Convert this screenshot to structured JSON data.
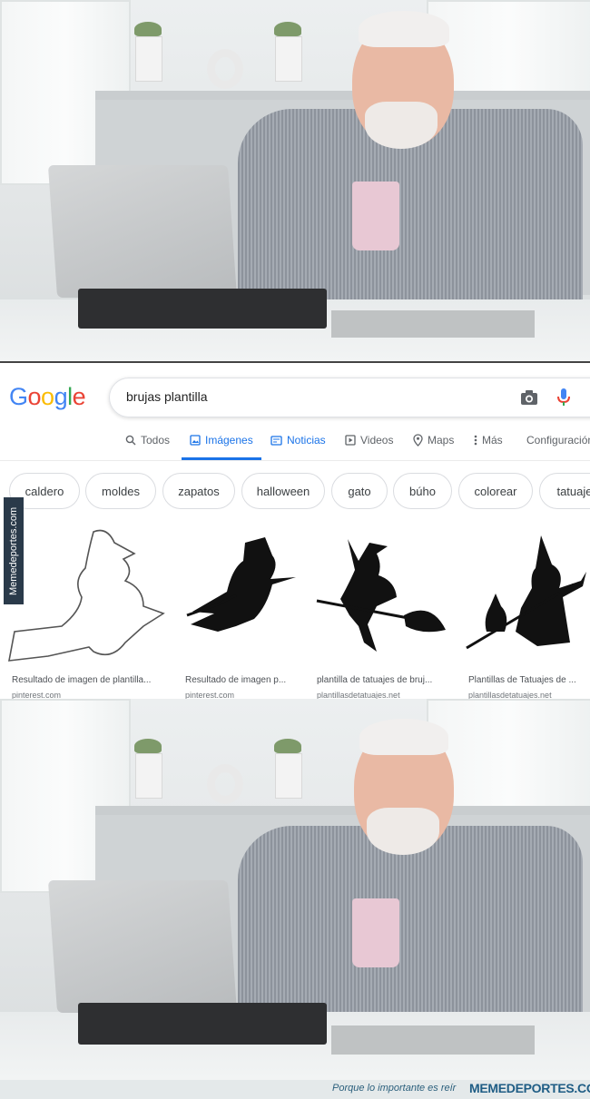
{
  "google": {
    "logo": "Google",
    "search_query": "brujas plantilla",
    "tabs": [
      {
        "label": "Todos",
        "icon": "search-icon"
      },
      {
        "label": "Imágenes",
        "icon": "image-icon"
      },
      {
        "label": "Noticias",
        "icon": "news-icon"
      },
      {
        "label": "Videos",
        "icon": "play-icon"
      },
      {
        "label": "Maps",
        "icon": "pin-icon"
      },
      {
        "label": "Más",
        "icon": "more-icon"
      },
      {
        "label": "Configuración",
        "icon": ""
      }
    ],
    "chips": [
      "caldero",
      "moldes",
      "zapatos",
      "halloween",
      "gato",
      "búho",
      "colorear",
      "tatuaje"
    ],
    "results": [
      {
        "caption": "Resultado de imagen de plantilla...",
        "source": "pinterest.com"
      },
      {
        "caption": "Resultado de imagen p...",
        "source": "pinterest.com"
      },
      {
        "caption": "plantilla de tatuajes de bruj...",
        "source": "plantillasdetatuajes.net"
      },
      {
        "caption": "Plantillas de Tatuajes de ...",
        "source": "plantillasdetatuajes.net"
      }
    ],
    "colors": {
      "active": "#1a73e8",
      "blue": "#4285F4",
      "red": "#EA4335",
      "yellow": "#FBBC05",
      "green": "#34A853"
    }
  },
  "watermark": {
    "side": "Memedeportes.com",
    "tagline": "Porque lo importante es reír",
    "brand": "MEMEDEPORTES.COM"
  }
}
